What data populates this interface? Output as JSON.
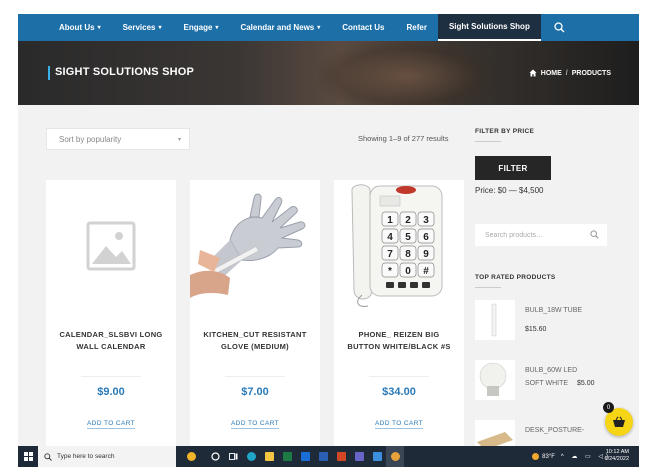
{
  "nav": {
    "items": [
      {
        "label": "About Us",
        "has_dropdown": true
      },
      {
        "label": "Services",
        "has_dropdown": true
      },
      {
        "label": "Engage",
        "has_dropdown": true
      },
      {
        "label": "Calendar and News",
        "has_dropdown": true
      },
      {
        "label": "Contact Us",
        "has_dropdown": false
      },
      {
        "label": "Refer",
        "has_dropdown": false
      },
      {
        "label": "Sight Solutions Shop",
        "has_dropdown": false,
        "active": true
      }
    ],
    "caret": "▾",
    "search_icon": "search-icon"
  },
  "hero": {
    "title": "SIGHT SOLUTIONS SHOP",
    "breadcrumb_home": "HOME",
    "breadcrumb_sep": "/",
    "breadcrumb_current": "PRODUCTS"
  },
  "toolbar": {
    "sort_value": "Sort by popularity",
    "result_count": "Showing 1–9 of 277 results"
  },
  "products": [
    {
      "name": "CALENDAR_SLSBVI LONG WALL CALENDAR",
      "price": "$9.00",
      "cart_label": "ADD TO CART",
      "image": "placeholder-image-icon"
    },
    {
      "name": "KITCHEN_CUT RESISTANT GLOVE (MEDIUM)",
      "price": "$7.00",
      "cart_label": "ADD TO CART",
      "image": "glove-photo"
    },
    {
      "name": "PHONE_ REIZEN BIG BUTTON WHITE/BLACK #S",
      "price": "$34.00",
      "cart_label": "ADD TO CART",
      "image": "phone-photo"
    }
  ],
  "sidebar": {
    "filter_heading": "FILTER BY PRICE",
    "filter_button": "FILTER",
    "price_range": "Price: $0 — $4,500",
    "search_placeholder": "Search products…",
    "top_rated_heading": "TOP RATED PRODUCTS",
    "top_rated": [
      {
        "name": "BULB_18W TUBE",
        "price": "$15.60"
      },
      {
        "name": "BULB_60W LED",
        "name2": "SOFT WHITE",
        "price": "$5.00"
      },
      {
        "name": "DESK_POSTURE-",
        "price": ""
      }
    ]
  },
  "cart": {
    "count": "0"
  },
  "taskbar": {
    "search_placeholder": "Type here to search",
    "weather": "83°F",
    "time": "10:12 AM",
    "date": "6/24/2022"
  },
  "colors": {
    "nav_bg": "#1d6fa8",
    "active_nav": "#1f2f42",
    "price_blue": "#2a7ab8",
    "cart_yellow": "#f6d517"
  }
}
